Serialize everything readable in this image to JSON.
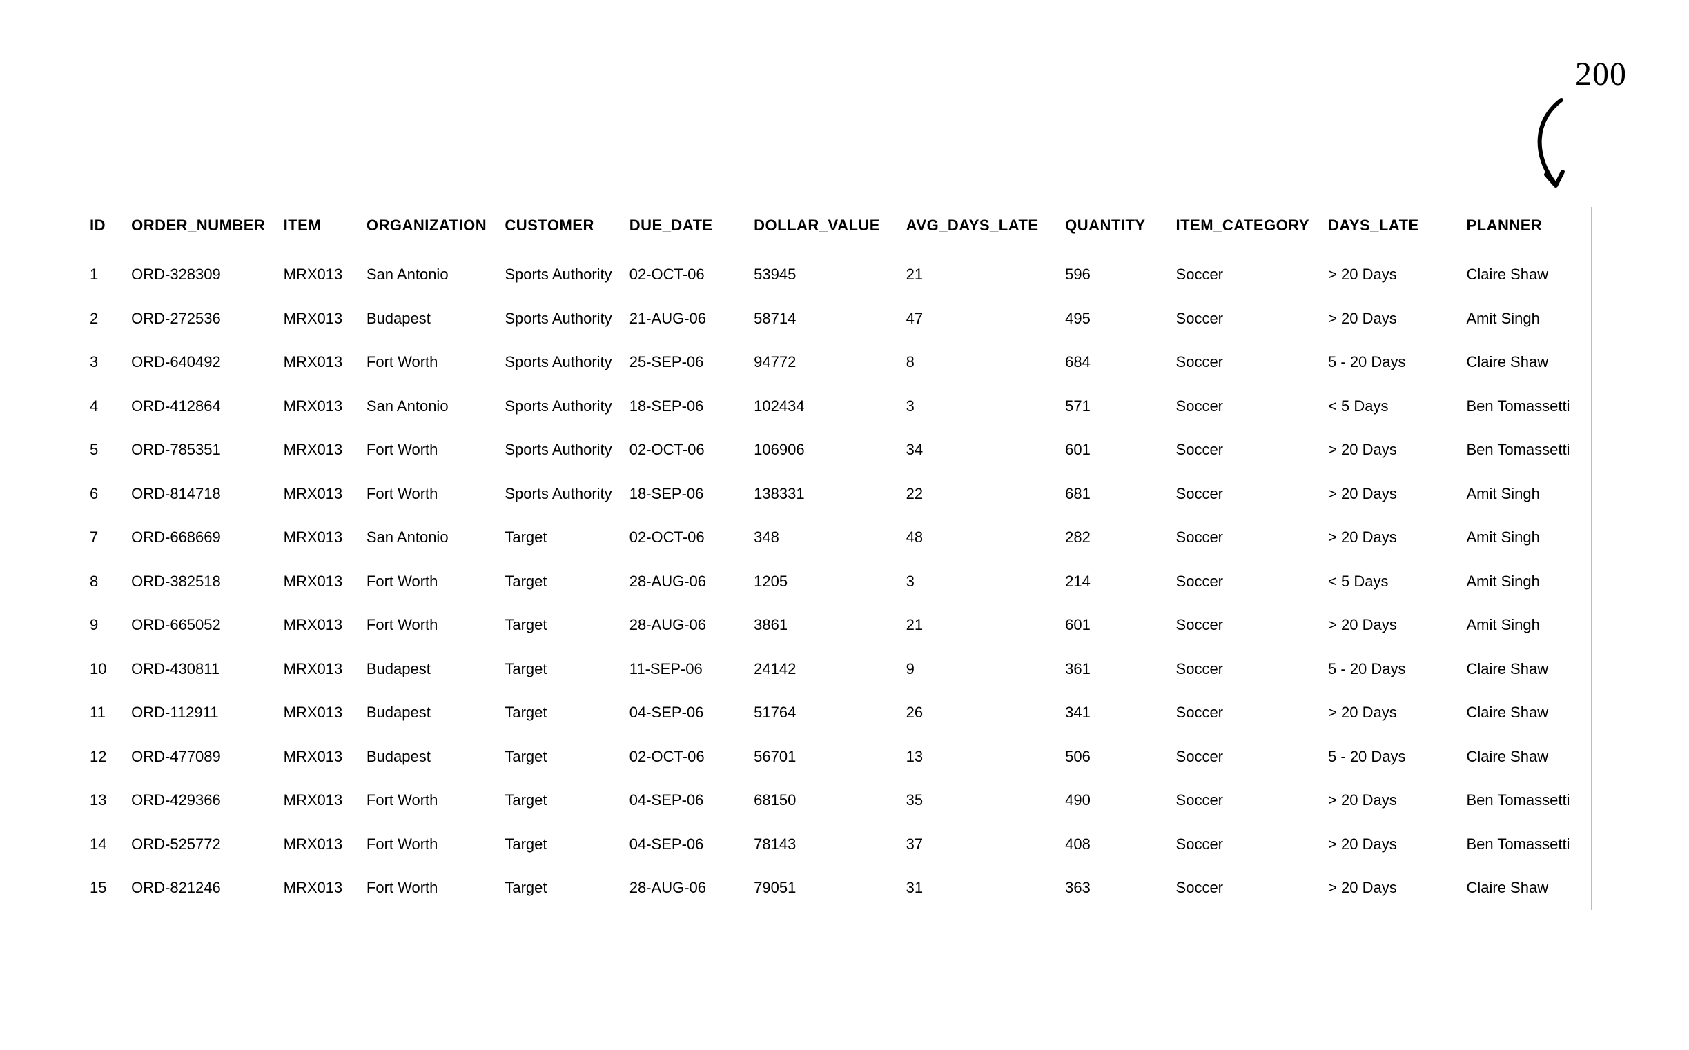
{
  "figure_label": "200",
  "columns": [
    "ID",
    "ORDER_NUMBER",
    "ITEM",
    "ORGANIZATION",
    "CUSTOMER",
    "DUE_DATE",
    "DOLLAR_VALUE",
    "AVG_DAYS_LATE",
    "QUANTITY",
    "ITEM_CATEGORY",
    "DAYS_LATE",
    "PLANNER"
  ],
  "rows": [
    {
      "id": "1",
      "order_number": "ORD-328309",
      "item": "MRX013",
      "organization": "San Antonio",
      "customer": "Sports Authority",
      "due_date": "02-OCT-06",
      "dollar_value": "53945",
      "avg_days_late": "21",
      "quantity": "596",
      "item_category": "Soccer",
      "days_late": "> 20 Days",
      "planner": "Claire Shaw"
    },
    {
      "id": "2",
      "order_number": "ORD-272536",
      "item": "MRX013",
      "organization": "Budapest",
      "customer": "Sports Authority",
      "due_date": "21-AUG-06",
      "dollar_value": "58714",
      "avg_days_late": "47",
      "quantity": "495",
      "item_category": "Soccer",
      "days_late": "> 20 Days",
      "planner": "Amit Singh"
    },
    {
      "id": "3",
      "order_number": "ORD-640492",
      "item": "MRX013",
      "organization": "Fort Worth",
      "customer": "Sports Authority",
      "due_date": "25-SEP-06",
      "dollar_value": "94772",
      "avg_days_late": "8",
      "quantity": "684",
      "item_category": "Soccer",
      "days_late": "5 - 20 Days",
      "planner": "Claire Shaw"
    },
    {
      "id": "4",
      "order_number": "ORD-412864",
      "item": "MRX013",
      "organization": "San Antonio",
      "customer": "Sports Authority",
      "due_date": "18-SEP-06",
      "dollar_value": "102434",
      "avg_days_late": "3",
      "quantity": "571",
      "item_category": "Soccer",
      "days_late": "< 5 Days",
      "planner": "Ben Tomassetti"
    },
    {
      "id": "5",
      "order_number": "ORD-785351",
      "item": "MRX013",
      "organization": "Fort Worth",
      "customer": "Sports Authority",
      "due_date": "02-OCT-06",
      "dollar_value": "106906",
      "avg_days_late": "34",
      "quantity": "601",
      "item_category": "Soccer",
      "days_late": "> 20 Days",
      "planner": "Ben Tomassetti"
    },
    {
      "id": "6",
      "order_number": "ORD-814718",
      "item": "MRX013",
      "organization": "Fort Worth",
      "customer": "Sports Authority",
      "due_date": "18-SEP-06",
      "dollar_value": "138331",
      "avg_days_late": "22",
      "quantity": "681",
      "item_category": "Soccer",
      "days_late": "> 20 Days",
      "planner": "Amit Singh"
    },
    {
      "id": "7",
      "order_number": "ORD-668669",
      "item": "MRX013",
      "organization": "San Antonio",
      "customer": "Target",
      "due_date": "02-OCT-06",
      "dollar_value": "348",
      "avg_days_late": "48",
      "quantity": "282",
      "item_category": "Soccer",
      "days_late": "> 20 Days",
      "planner": "Amit Singh"
    },
    {
      "id": "8",
      "order_number": "ORD-382518",
      "item": "MRX013",
      "organization": "Fort Worth",
      "customer": "Target",
      "due_date": "28-AUG-06",
      "dollar_value": "1205",
      "avg_days_late": "3",
      "quantity": "214",
      "item_category": "Soccer",
      "days_late": "< 5 Days",
      "planner": "Amit Singh"
    },
    {
      "id": "9",
      "order_number": "ORD-665052",
      "item": "MRX013",
      "organization": "Fort Worth",
      "customer": "Target",
      "due_date": "28-AUG-06",
      "dollar_value": "3861",
      "avg_days_late": "21",
      "quantity": "601",
      "item_category": "Soccer",
      "days_late": "> 20 Days",
      "planner": "Amit Singh"
    },
    {
      "id": "10",
      "order_number": "ORD-430811",
      "item": "MRX013",
      "organization": "Budapest",
      "customer": "Target",
      "due_date": "11-SEP-06",
      "dollar_value": "24142",
      "avg_days_late": "9",
      "quantity": "361",
      "item_category": "Soccer",
      "days_late": "5 - 20 Days",
      "planner": "Claire Shaw"
    },
    {
      "id": "11",
      "order_number": "ORD-112911",
      "item": "MRX013",
      "organization": "Budapest",
      "customer": "Target",
      "due_date": "04-SEP-06",
      "dollar_value": "51764",
      "avg_days_late": "26",
      "quantity": "341",
      "item_category": "Soccer",
      "days_late": "> 20 Days",
      "planner": "Claire Shaw"
    },
    {
      "id": "12",
      "order_number": "ORD-477089",
      "item": "MRX013",
      "organization": "Budapest",
      "customer": "Target",
      "due_date": "02-OCT-06",
      "dollar_value": "56701",
      "avg_days_late": "13",
      "quantity": "506",
      "item_category": "Soccer",
      "days_late": "5 - 20 Days",
      "planner": "Claire Shaw"
    },
    {
      "id": "13",
      "order_number": "ORD-429366",
      "item": "MRX013",
      "organization": "Fort Worth",
      "customer": "Target",
      "due_date": "04-SEP-06",
      "dollar_value": "68150",
      "avg_days_late": "35",
      "quantity": "490",
      "item_category": "Soccer",
      "days_late": "> 20 Days",
      "planner": "Ben Tomassetti"
    },
    {
      "id": "14",
      "order_number": "ORD-525772",
      "item": "MRX013",
      "organization": "Fort Worth",
      "customer": "Target",
      "due_date": "04-SEP-06",
      "dollar_value": "78143",
      "avg_days_late": "37",
      "quantity": "408",
      "item_category": "Soccer",
      "days_late": "> 20 Days",
      "planner": "Ben Tomassetti"
    },
    {
      "id": "15",
      "order_number": "ORD-821246",
      "item": "MRX013",
      "organization": "Fort Worth",
      "customer": "Target",
      "due_date": "28-AUG-06",
      "dollar_value": "79051",
      "avg_days_late": "31",
      "quantity": "363",
      "item_category": "Soccer",
      "days_late": "> 20 Days",
      "planner": "Claire Shaw"
    }
  ]
}
